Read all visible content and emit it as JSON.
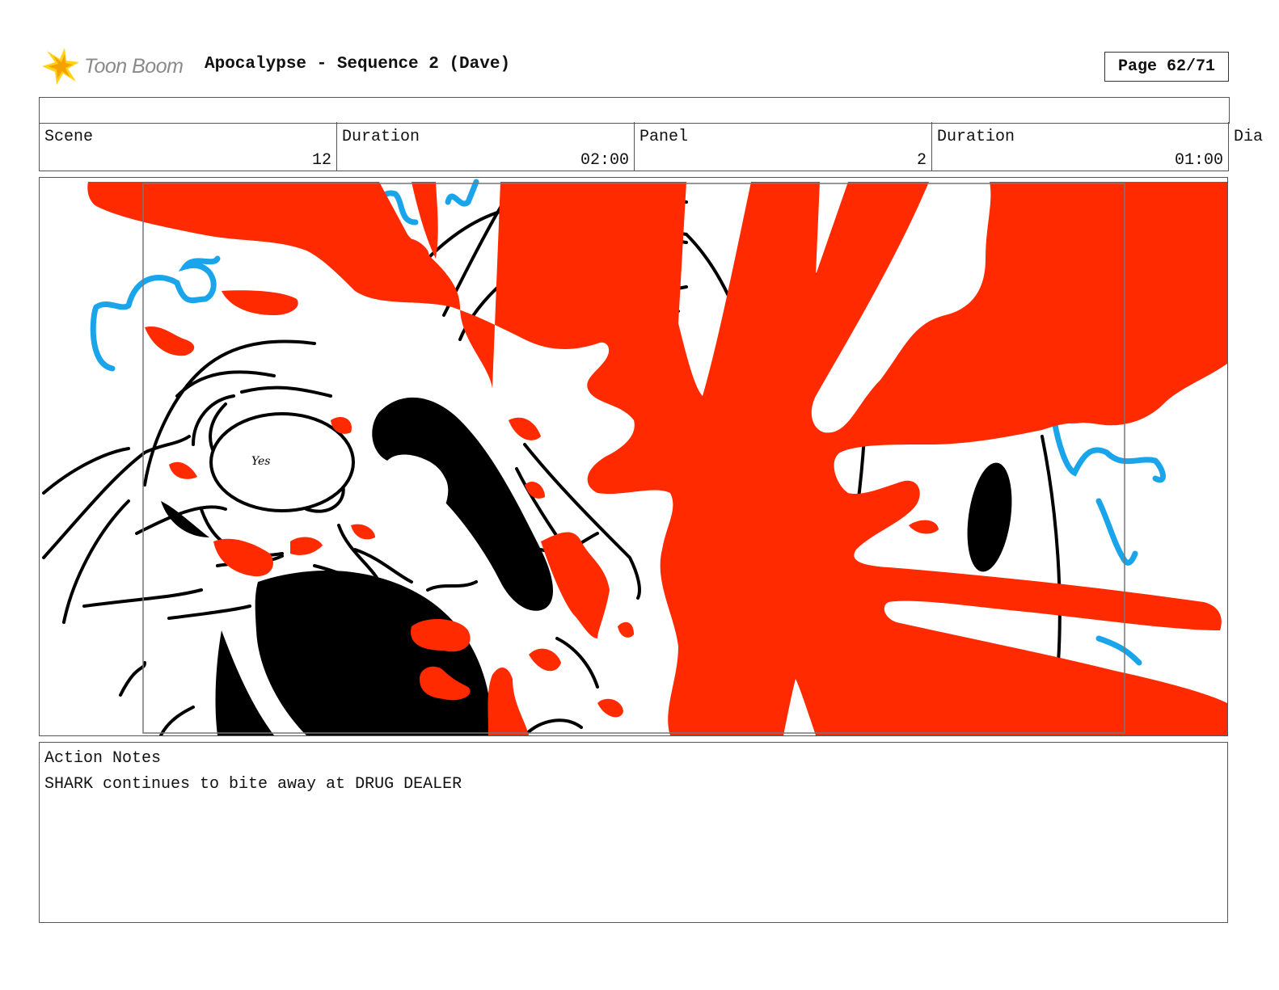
{
  "header": {
    "logo_text": "Toon Boom",
    "title": "Apocalypse - Sequence 2 (Dave)",
    "page_indicator": "Page 62/71"
  },
  "info": {
    "scene_label": "Scene",
    "scene_value": "12",
    "scene_duration_label": "Duration",
    "scene_duration_value": "02:00",
    "panel_label": "Panel",
    "panel_value": "2",
    "panel_duration_label": "Duration",
    "panel_duration_value": "01:00",
    "dialogue_label": "Dia"
  },
  "panel_art": {
    "description_icon": "storyboard-drawing",
    "colors": {
      "blood": "#ff2a00",
      "ink": "#000000",
      "water": "#1aa5ea"
    },
    "scribble_text": "Yes"
  },
  "notes": {
    "label": "Action Notes",
    "text": "SHARK continues to bite away at DRUG DEALER"
  }
}
